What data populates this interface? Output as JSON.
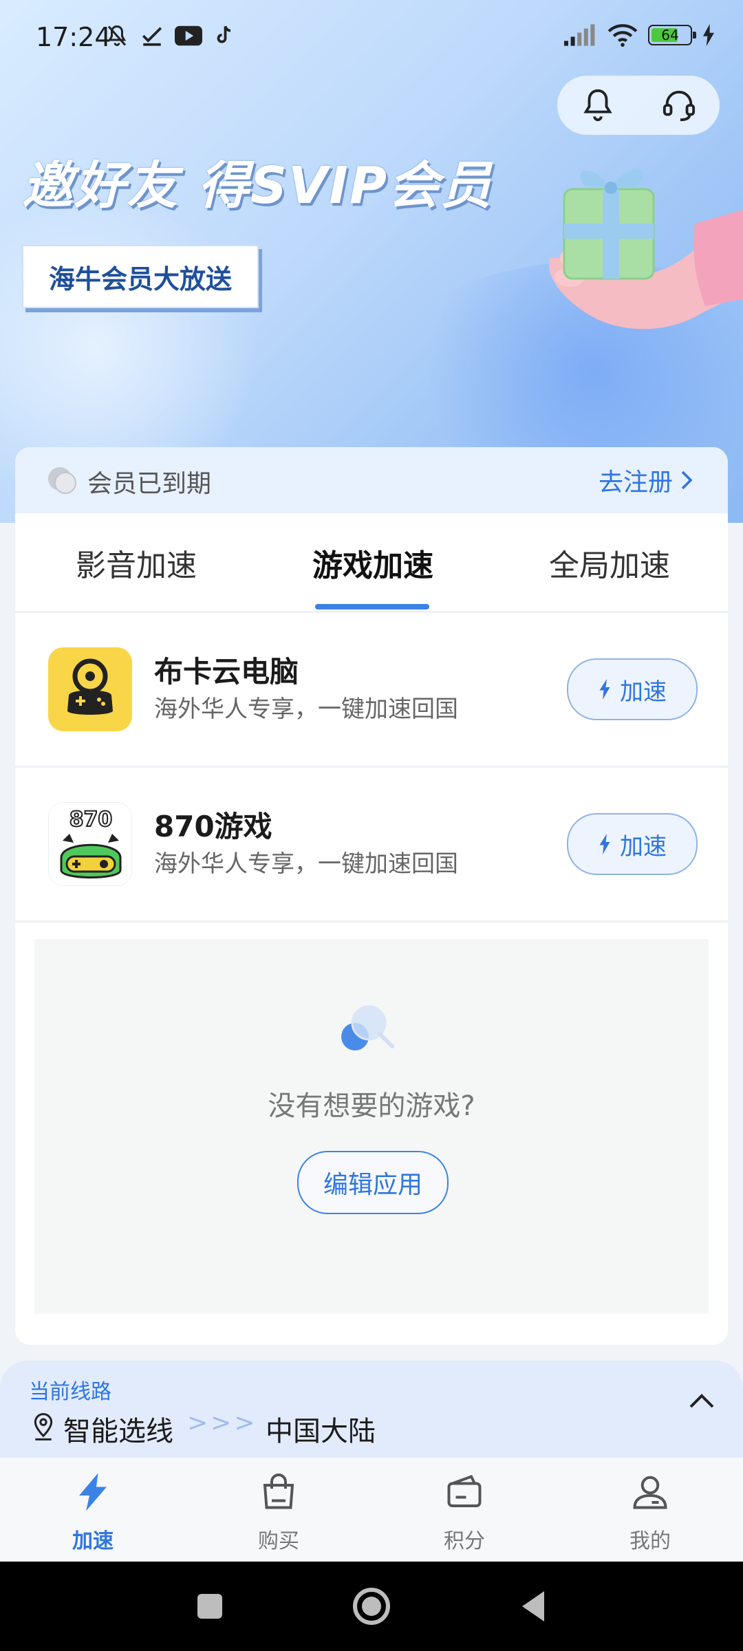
{
  "status_bar": {
    "time": "17:24",
    "battery": "64",
    "icons_left": [
      "mute-bell-icon",
      "check-icon",
      "youtube-icon",
      "tiktok-icon"
    ],
    "icons_right": [
      "signal-icon",
      "wifi-icon",
      "battery-icon",
      "charging-icon"
    ]
  },
  "banner": {
    "headline": "邀好友 得SVIP会员",
    "promo_button": "海牛会员大放送",
    "top_icons": [
      "bell-icon",
      "headset-icon"
    ]
  },
  "membership": {
    "status": "会员已到期",
    "register_link": "去注册"
  },
  "tabs": [
    {
      "label": "影音加速",
      "active": false
    },
    {
      "label": "游戏加速",
      "active": true
    },
    {
      "label": "全局加速",
      "active": false
    }
  ],
  "games": [
    {
      "name": "布卡云电脑",
      "subtitle": "海外华人专享，一键加速回国",
      "button": "加速"
    },
    {
      "name": "870游戏",
      "subtitle": "海外华人专享，一键加速回国",
      "button": "加速",
      "icon_text": "870"
    }
  ],
  "empty_state": {
    "message": "没有想要的游戏?",
    "button": "编辑应用"
  },
  "route": {
    "label": "当前线路",
    "mode": "智能选线",
    "arrows": ">>>",
    "region": "中国大陆"
  },
  "bottom_nav": [
    {
      "label": "加速",
      "icon": "lightning-icon",
      "active": true
    },
    {
      "label": "购买",
      "icon": "shopping-bag-icon",
      "active": false
    },
    {
      "label": "积分",
      "icon": "wallet-icon",
      "active": false
    },
    {
      "label": "我的",
      "icon": "profile-icon",
      "active": false
    }
  ],
  "colors": {
    "accent": "#2f76df",
    "banner_start": "#d9ecff",
    "banner_end": "#8db9f4"
  }
}
